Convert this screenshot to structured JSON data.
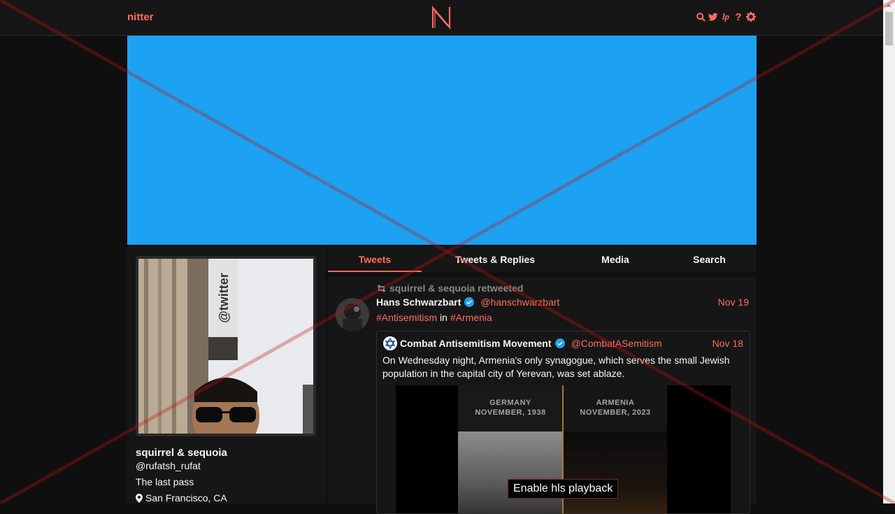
{
  "navbar": {
    "brand": "nitter",
    "icons": [
      "search-icon",
      "twitter-icon",
      "lp-icon",
      "help-icon",
      "settings-icon"
    ],
    "lp_label": "lp",
    "help_label": "?"
  },
  "colors": {
    "accent": "#ff6c60",
    "banner": "#1da1f2",
    "background": "#0f0f0f",
    "panel": "#161616",
    "verified": "#1da1f2"
  },
  "profile": {
    "fullname": "squirrel & sequoia",
    "username": "@rufatsh_rufat",
    "bio": "The last pass",
    "location": "San Francisco, CA"
  },
  "tabs": [
    {
      "label": "Tweets",
      "active": true
    },
    {
      "label": "Tweets & Replies",
      "active": false
    },
    {
      "label": "Media",
      "active": false
    },
    {
      "label": "Search",
      "active": false
    }
  ],
  "tweet": {
    "retweet_header": "squirrel & sequoia retweeted",
    "fullname": "Hans Schwarzbart",
    "username": "@hanschwarzbart",
    "date": "Nov 19",
    "hashtag1": "#Antisemitism",
    "connector": " in ",
    "hashtag2": "#Armenia",
    "quote": {
      "fullname": "Combat Antisemitism Movement",
      "username": "@CombatASemitism",
      "date": "Nov 18",
      "text": "On Wednesday night, Armenia's only synagogue, which serves the small Jewish population in the capital city of Yerevan, was set ablaze.",
      "media": {
        "left_label_line1": "GERMANY",
        "left_label_line2": "NOVEMBER, 1938",
        "right_label_line1": "ARMENIA",
        "right_label_line2": "NOVEMBER, 2023",
        "play_button": "Enable hls playback"
      }
    }
  }
}
